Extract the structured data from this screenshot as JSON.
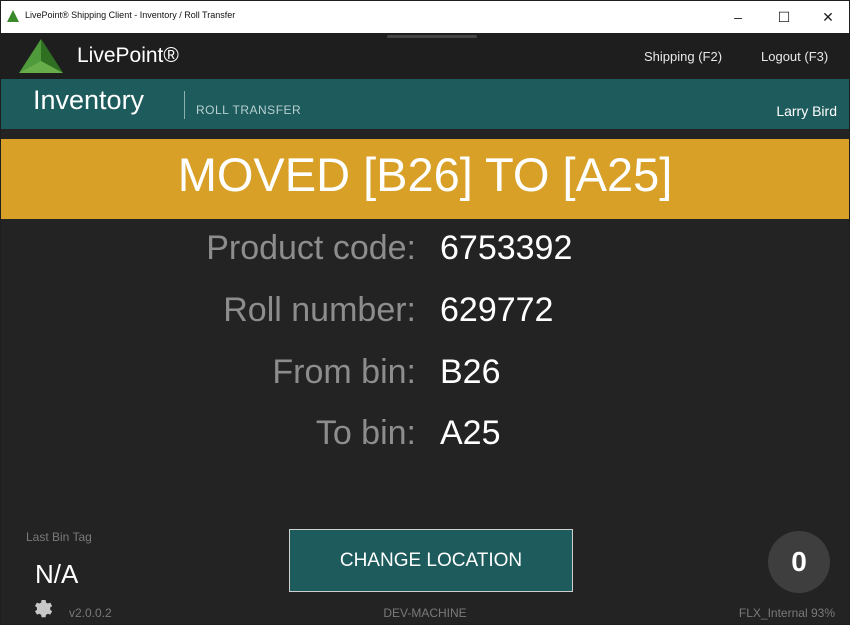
{
  "window": {
    "title": "LivePoint® Shipping Client - Inventory / Roll Transfer",
    "app_icon": "app-triangle-icon",
    "minimize_glyph": "–",
    "maximize_glyph": "☐",
    "close_glyph": "✕"
  },
  "header": {
    "brand": "LivePoint®",
    "logo_icon": "livepoint-logo-icon",
    "nav": {
      "shipping": "Shipping (F2)",
      "logout": "Logout (F3)"
    }
  },
  "subheader": {
    "section": "Inventory",
    "subsection": "ROLL TRANSFER",
    "user": "Larry Bird"
  },
  "banner": {
    "message": "MOVED [B26] TO [A25]",
    "color": "#d8a027"
  },
  "details": {
    "product_code": {
      "label": "Product code:",
      "value": "6753392"
    },
    "roll_number": {
      "label": "Roll number:",
      "value": "629772"
    },
    "from_bin": {
      "label": "From bin:",
      "value": "B26"
    },
    "to_bin": {
      "label": "To bin:",
      "value": "A25"
    }
  },
  "last_bin_tag": {
    "label": "Last Bin Tag",
    "value": "N/A"
  },
  "actions": {
    "change_location": "CHANGE LOCATION"
  },
  "counter": "0",
  "footer": {
    "settings_icon": "gear-icon",
    "version": "v2.0.0.2",
    "machine": "DEV-MACHINE",
    "connection": "FLX_Internal",
    "signal": "93%"
  },
  "colors": {
    "accent_teal": "#1e5b5c",
    "banner_gold": "#d8a027",
    "background": "#232323"
  }
}
